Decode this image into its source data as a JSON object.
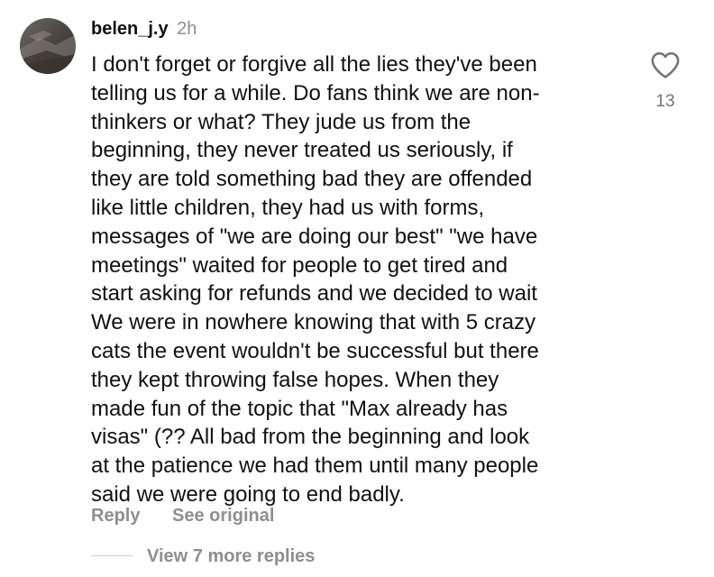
{
  "comment": {
    "username": "belen_j.y",
    "timestamp": "2h",
    "text": "I don't forget or forgive all the lies they've been\ntelling us for a while. Do fans think we are non-\nthinkers or what? They jude us from the\nbeginning, they never treated us seriously, if\nthey are told something bad they are offended\nlike little children, they had us with forms,\nmessages of \"we are doing our best\" \"we have\nmeetings\" waited for people to get tired and\nstart asking for refunds and we decided to wait\nWe were in nowhere knowing that with 5 crazy\ncats the event wouldn't be successful but there\nthey kept throwing false hopes. When they\nmade fun of the topic that \"Max already has\nvisas\" (?? All bad from the beginning and look\nat the patience we had them until many people\nsaid we were going to end badly.",
    "like_count": "13",
    "like_icon": "heart-outline-icon",
    "reply_label": "Reply",
    "see_original_label": "See original",
    "view_replies_label": "View 7 more replies"
  },
  "colors": {
    "text": "#111111",
    "secondary": "#8e8e8e",
    "like_count": "#737373"
  }
}
